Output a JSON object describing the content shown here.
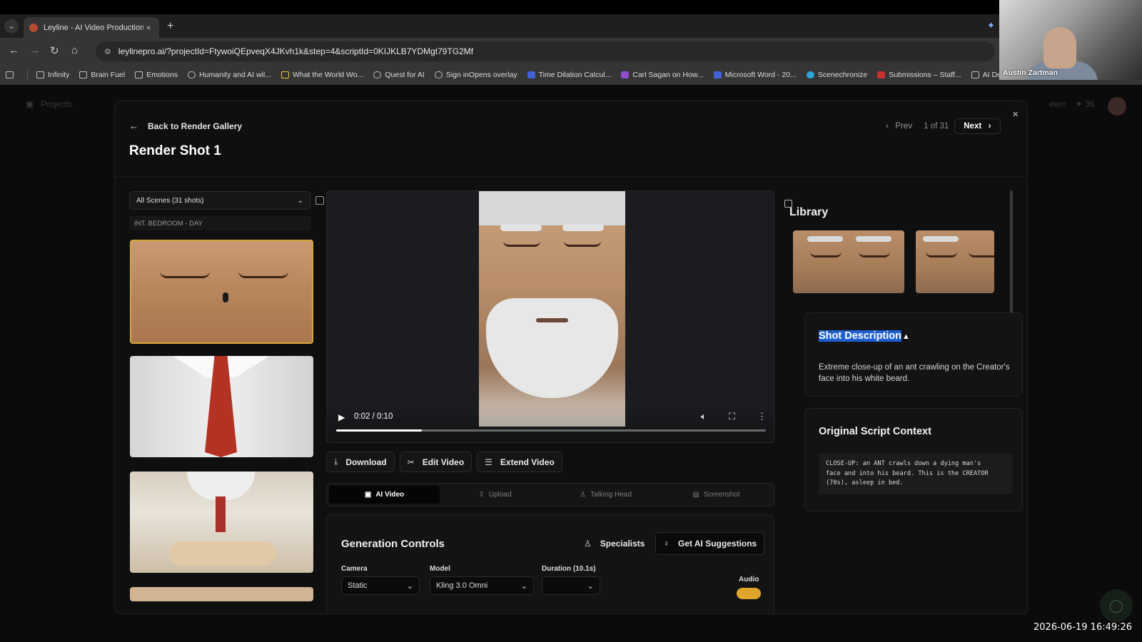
{
  "browser": {
    "tab_title": "Leyline - AI Video Production P",
    "tab_close": "×",
    "new_tab": "+",
    "url": "leylinepro.ai/?projectId=FtywoiQEpveqX4JKvh1k&step=4&scriptId=0KIJKLB7YDMgt79TG2Mf",
    "bookmarks": [
      {
        "label": "Infinity",
        "icon": "folder-icon"
      },
      {
        "label": "Brain Fuel",
        "icon": "folder-icon"
      },
      {
        "label": "Emotions",
        "icon": "folder-icon"
      },
      {
        "label": "Humanity and AI wil...",
        "icon": "globe-icon"
      },
      {
        "label": "What the World Wo...",
        "icon": "doc-icon"
      },
      {
        "label": "Quest for AI",
        "icon": "globe-icon"
      },
      {
        "label": "Sign inOpens overlay",
        "icon": "globe-icon"
      },
      {
        "label": "Time Dilation Calcul...",
        "icon": "calc-icon"
      },
      {
        "label": "Carl Sagan on How...",
        "icon": "shield-icon"
      },
      {
        "label": "Microsoft Word - 20...",
        "icon": "word-icon"
      },
      {
        "label": "Scenechronize",
        "icon": "scene-icon"
      },
      {
        "label": "Submissions – Staff...",
        "icon": "adobe-icon"
      },
      {
        "label": "AI Deve",
        "icon": "folder-icon"
      }
    ]
  },
  "webcam": {
    "name": "Austin Zartman"
  },
  "app": {
    "projects_label": "Projects",
    "right_fragment": "eem",
    "right_count": "36"
  },
  "timestamp": "2026-06-19 16:49:26",
  "modal": {
    "back_label": "Back to Render Gallery",
    "title": "Render Shot 1",
    "pager": {
      "prev": "Prev",
      "count": "1 of 31",
      "next": "Next"
    },
    "close": "×"
  },
  "sidebar": {
    "scene_select": "All Scenes (31 shots)",
    "scene_heading": "INT. BEDROOM - DAY",
    "shots": [
      {
        "name": "shot-1",
        "selected": true
      },
      {
        "name": "shot-2",
        "selected": false
      },
      {
        "name": "shot-3",
        "selected": false
      },
      {
        "name": "shot-4",
        "selected": false
      }
    ]
  },
  "player": {
    "time": "0:02 / 0:10",
    "progress": 0.2
  },
  "actions": [
    {
      "label": "Download",
      "icon": "download-icon",
      "glyph": "⤓"
    },
    {
      "label": "Edit Video",
      "icon": "scissors-icon",
      "glyph": "✂"
    },
    {
      "label": "Extend Video",
      "icon": "layers-icon",
      "glyph": "☰"
    }
  ],
  "modes": [
    {
      "label": "AI Video",
      "icon": "film-icon",
      "glyph": "▣",
      "active": true
    },
    {
      "label": "Upload",
      "icon": "upload-icon",
      "glyph": "⇪",
      "active": false
    },
    {
      "label": "Talking Head",
      "icon": "person-icon",
      "glyph": "♙",
      "active": false
    },
    {
      "label": "Screenshot",
      "icon": "screenshot-icon",
      "glyph": "▤",
      "active": false
    }
  ],
  "generation": {
    "title": "Generation Controls",
    "specialists": "Specialists",
    "suggestions": "Get AI Suggestions",
    "camera_label": "Camera",
    "camera_value": "Static",
    "model_label": "Model",
    "model_value": "Kling 3.0 Omni",
    "duration_label": "Duration (10.1s)",
    "duration_value": "",
    "audio_label": "Audio",
    "audio_on": true
  },
  "library": {
    "title": "Library"
  },
  "shot_description": {
    "title_highlight": "Shot Description",
    "body": "Extreme close-up of an ant crawling on the Creator's face into his white beard."
  },
  "script_context": {
    "title": "Original Script Context",
    "lines": [
      "CLOSE-UP: an ANT crawls down a dying man's",
      "face and into his beard. This is the CREATOR",
      "(70s), asleep in bed."
    ]
  },
  "colors": {
    "selected_border": "#d6a63b",
    "highlight": "#1f5fd0",
    "audio_toggle": "#e0a62b"
  }
}
